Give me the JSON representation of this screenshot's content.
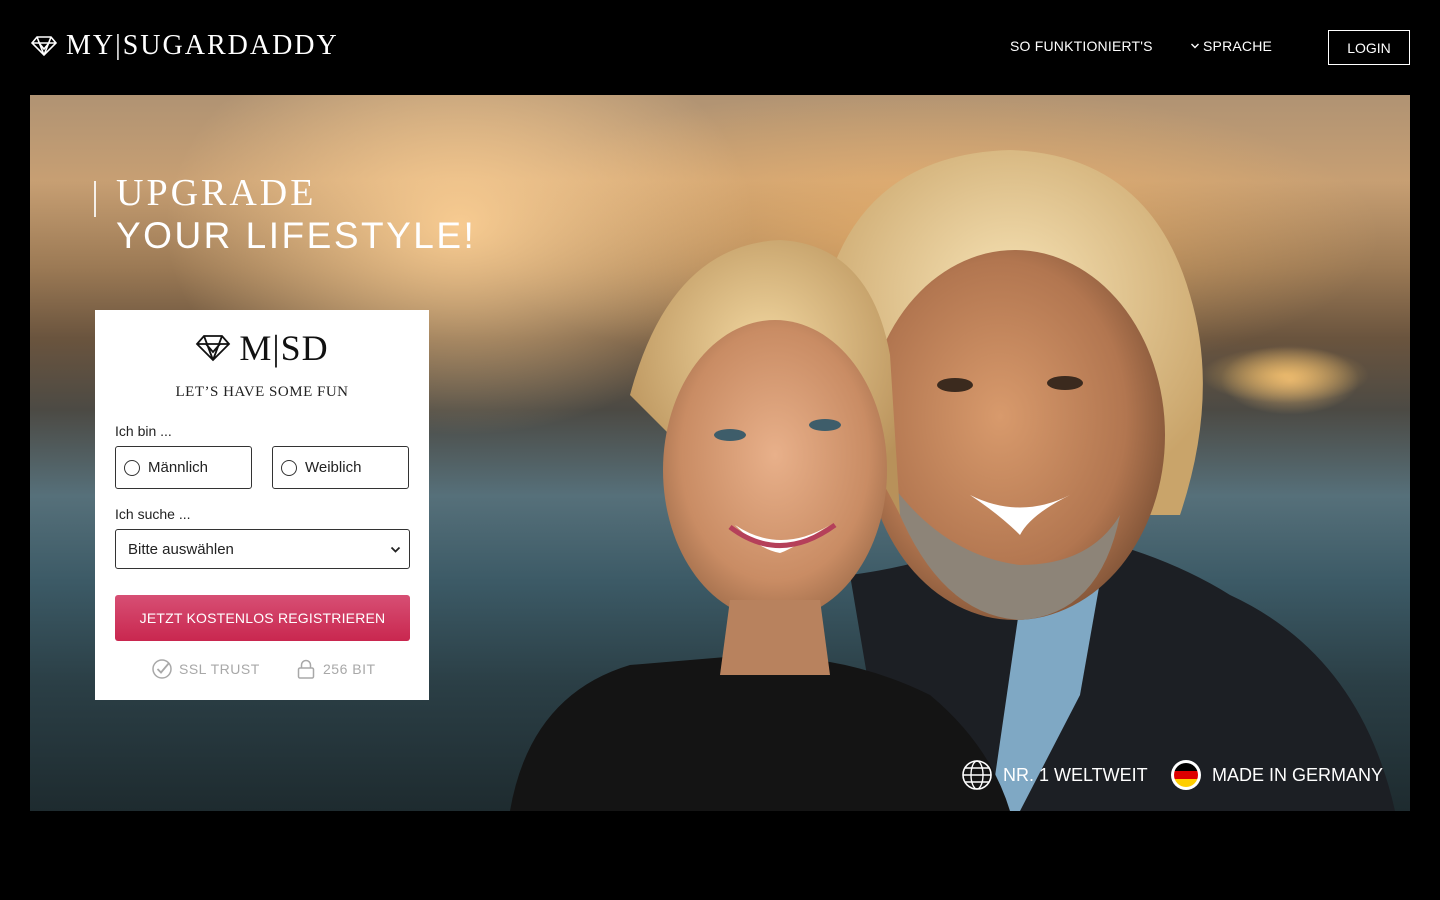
{
  "header": {
    "logo_text": "MY|SUGARDADDY",
    "nav_how": "SO FUNKTIONIERT'S",
    "nav_lang": "SPRACHE",
    "login": "LOGIN"
  },
  "hero": {
    "headline_1": "UPGRADE",
    "headline_2": "YOUR LIFESTYLE!"
  },
  "form": {
    "logo_text": "M|SD",
    "tagline": "LET’S HAVE SOME FUN",
    "iam_label": "Ich bin ...",
    "option_male": "Männlich",
    "option_female": "Weiblich",
    "seeking_label": "Ich suche ...",
    "select_value": "Bitte auswählen",
    "cta": "JETZT KOSTENLOS REGISTRIEREN",
    "trust_ssl": "SSL TRUST",
    "trust_bit": "256 BIT"
  },
  "badges": {
    "world": "NR. 1 WELTWEIT",
    "germany": "MADE IN GERMANY"
  },
  "colors": {
    "cta": "#c9274f",
    "background": "#000000"
  },
  "icons": [
    "diamond-logo-icon",
    "chevron-down-icon",
    "radio-icon",
    "check-circle-icon",
    "lock-icon",
    "globe-icon",
    "germany-flag-icon"
  ]
}
